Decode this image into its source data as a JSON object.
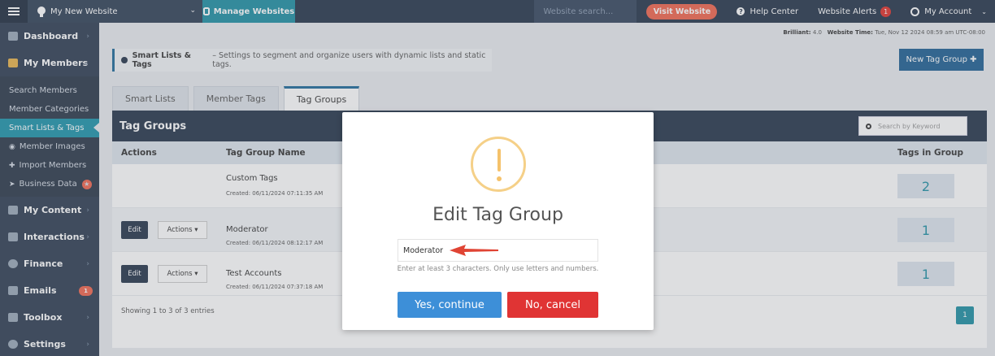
{
  "topbar": {
    "site_name": "My New Website",
    "manage_label": "Manage Websites",
    "search_placeholder": "Website search...",
    "visit_label": "Visit Website",
    "help_label": "Help Center",
    "alerts_label": "Website Alerts",
    "alerts_count": "1",
    "account_label": "My Account"
  },
  "sidebar": {
    "dashboard": "Dashboard",
    "members": "My Members",
    "sub_items": [
      "Search Members",
      "Member Categories",
      "Smart Lists & Tags",
      "Member Images",
      "Import Members",
      "Business Data"
    ],
    "content": "My Content",
    "interactions": "Interactions",
    "finance": "Finance",
    "emails": "Emails",
    "emails_badge": "1",
    "toolbox": "Toolbox",
    "settings": "Settings"
  },
  "meta": {
    "brilliant_label": "Brilliant:",
    "brilliant_value": "4.0",
    "time_label": "Website Time:",
    "time_value": "Tue, Nov 12 2024 08:59 am UTC-08:00"
  },
  "info": {
    "title": "Smart Lists & Tags",
    "desc": "– Settings to segment and organize users with dynamic lists and static tags."
  },
  "new_tag_button": "New Tag Group",
  "tabs": [
    "Smart Lists",
    "Member Tags",
    "Tag Groups"
  ],
  "panel": {
    "title": "Tag Groups",
    "search_placeholder": "Search by Keyword",
    "columns": {
      "actions": "Actions",
      "name": "Tag Group Name",
      "count": "Tags in Group"
    },
    "rows": [
      {
        "name": "Custom Tags",
        "created": "Created: 06/11/2024 07:11:35 AM",
        "count": "2"
      },
      {
        "name": "Moderator",
        "created": "Created: 06/11/2024 08:12:17 AM",
        "count": "1"
      },
      {
        "name": "Test Accounts",
        "created": "Created: 06/11/2024 07:37:18 AM",
        "count": "1"
      }
    ],
    "edit_label": "Edit",
    "actions_label": "Actions",
    "showing": "Showing 1 to 3 of 3 entries",
    "page": "1"
  },
  "modal": {
    "title": "Edit Tag Group",
    "input_value": "Moderator",
    "hint": "Enter at least 3 characters. Only use letters and numbers.",
    "confirm": "Yes, continue",
    "cancel": "No, cancel"
  }
}
